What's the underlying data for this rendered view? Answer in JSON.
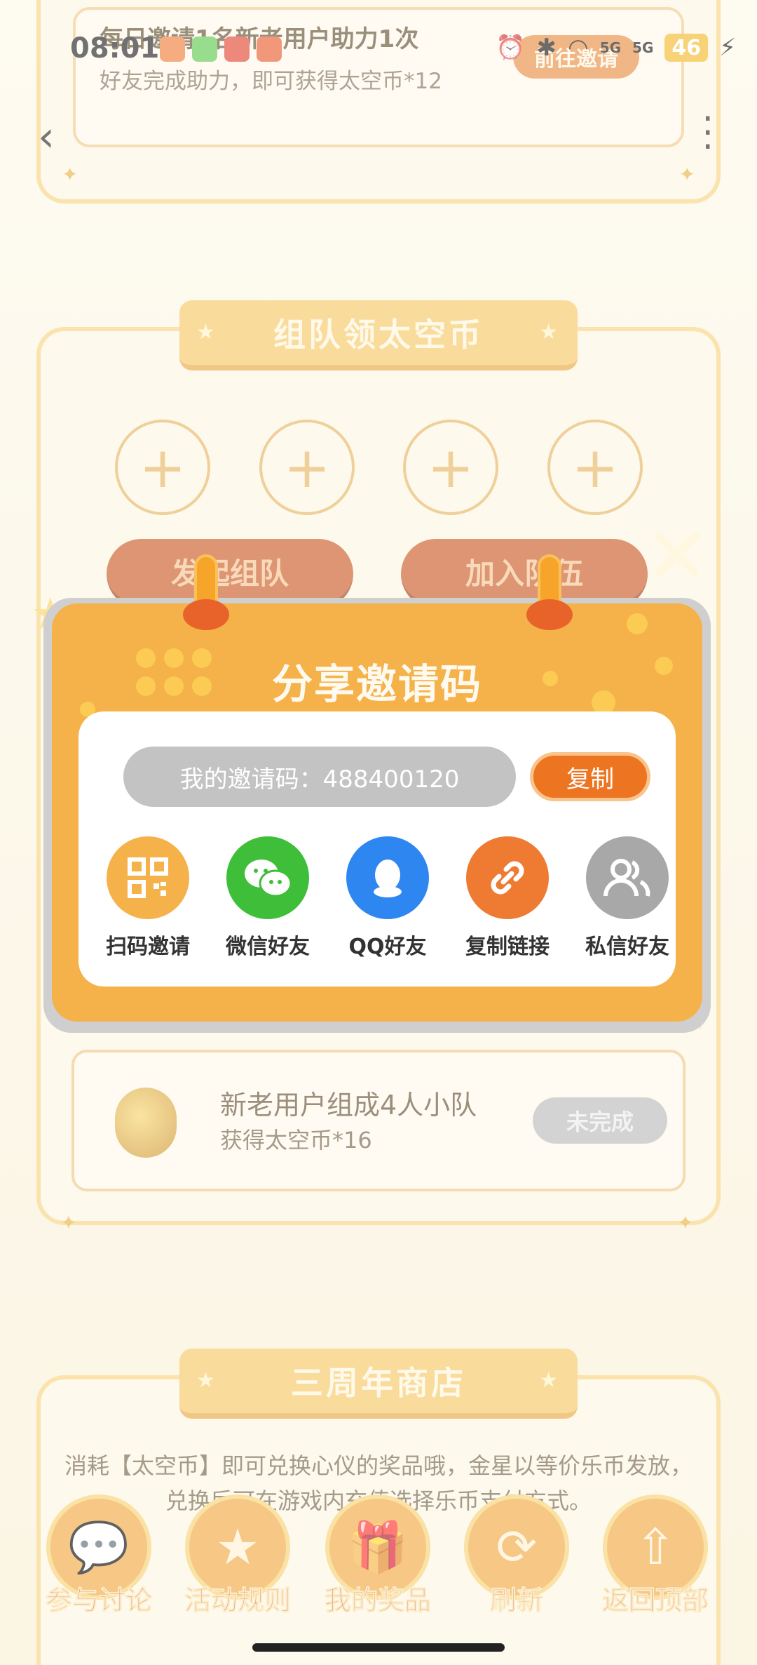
{
  "status": {
    "time": "08:01",
    "network": "5G",
    "battery": "46"
  },
  "invite_task": {
    "title": "每日邀请1名新老用户助力1次",
    "subtitle": "好友完成助力，即可获得太空币*12",
    "button": "前往邀请"
  },
  "team_section": {
    "title": "组队领太空币",
    "slot_icon": "plus-icon",
    "start_button": "发起组队",
    "join_button": "加入队伍"
  },
  "team_quest": {
    "title": "新老用户组成4人小队",
    "subtitle": "获得太空币*16",
    "button": "未完成"
  },
  "shop_section": {
    "title": "三周年商店",
    "desc_line1": "消耗【太空币】即可兑换心仪的奖品哦，金星以等价乐币发放，",
    "desc_line2": "兑换后可在游戏内充值选择乐币支付方式。"
  },
  "bottom_nav": [
    {
      "label": "参与讨论",
      "icon": "chat-icon"
    },
    {
      "label": "活动规则",
      "icon": "rules-icon"
    },
    {
      "label": "我的奖品",
      "icon": "gift-icon"
    },
    {
      "label": "刷新",
      "icon": "refresh-icon"
    },
    {
      "label": "返回顶部",
      "icon": "back-to-top-icon"
    }
  ],
  "modal": {
    "title": "分享邀请码",
    "code_text": "我的邀请码：488400120",
    "copy_button": "复制",
    "share_options": [
      {
        "label": "扫码邀请",
        "icon": "qr-code-icon",
        "color": "#f5b24a"
      },
      {
        "label": "微信好友",
        "icon": "wechat-icon",
        "color": "#3fbe3a"
      },
      {
        "label": "QQ好友",
        "icon": "qq-icon",
        "color": "#2e86f0"
      },
      {
        "label": "复制链接",
        "icon": "link-icon",
        "color": "#ef7a32"
      },
      {
        "label": "私信好友",
        "icon": "users-icon",
        "color": "#a8a8a8"
      }
    ]
  },
  "colors": {
    "accent_orange": "#f5b24a",
    "copy_button": "#ed7420",
    "modal_card": "#ffffff"
  }
}
